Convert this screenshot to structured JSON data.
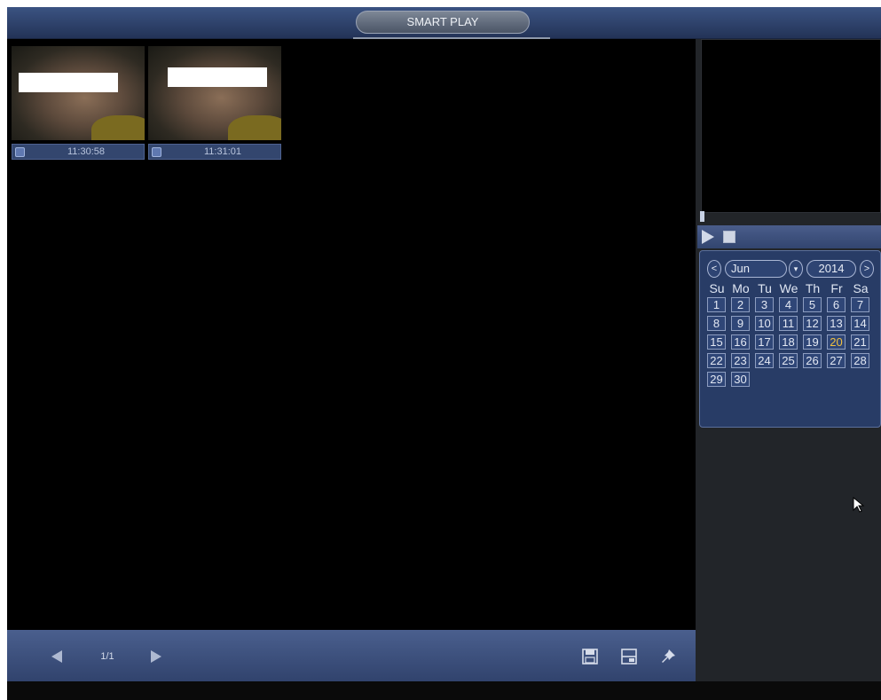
{
  "title": "SMART PLAY",
  "thumbnails": [
    {
      "time": "11:30:58"
    },
    {
      "time": "11:31:01"
    }
  ],
  "pagination": {
    "page": "1/1"
  },
  "calendar": {
    "month": "Jun",
    "year": "2014",
    "prev_symbol": "<",
    "next_symbol": ">",
    "dropdown_symbol": "▾",
    "weekdays": [
      "Su",
      "Mo",
      "Tu",
      "We",
      "Th",
      "Fr",
      "Sa"
    ],
    "weeks": [
      [
        "1",
        "2",
        "3",
        "4",
        "5",
        "6",
        "7"
      ],
      [
        "8",
        "9",
        "10",
        "11",
        "12",
        "13",
        "14"
      ],
      [
        "15",
        "16",
        "17",
        "18",
        "19",
        "20",
        "21"
      ],
      [
        "22",
        "23",
        "24",
        "25",
        "26",
        "27",
        "28"
      ],
      [
        "29",
        "30"
      ]
    ],
    "highlighted_day": "20",
    "highlight_color": "#f0c040"
  },
  "icons": {
    "prev": "triangle-left-icon",
    "next": "triangle-right-icon",
    "save": "save-icon",
    "layout": "split-screen-icon",
    "pin": "pin-icon",
    "play": "play-icon",
    "stop": "stop-icon",
    "cursor": "mouse-cursor-icon"
  }
}
